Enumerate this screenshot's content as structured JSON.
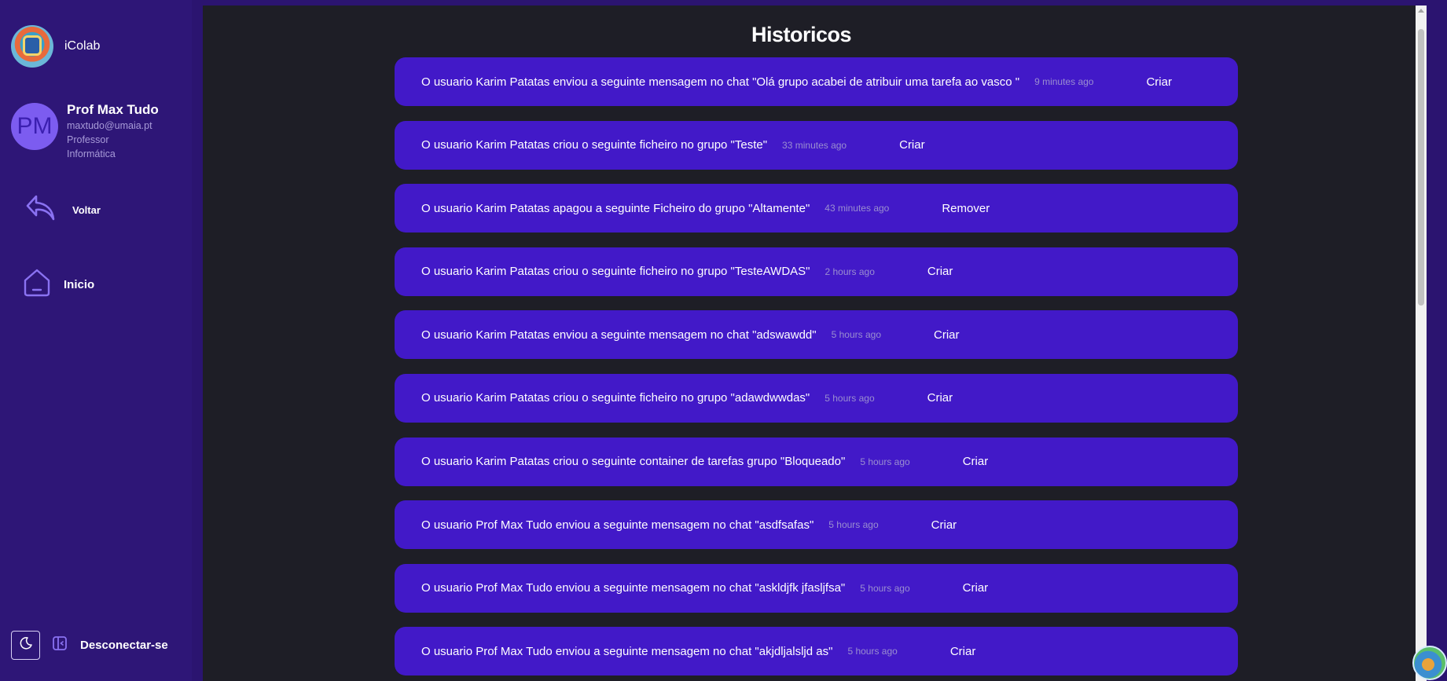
{
  "app": {
    "name": "iColab"
  },
  "profile": {
    "initials": "PM",
    "name": "Prof Max Tudo",
    "email": "maxtudo@umaia.pt",
    "role": "Professor",
    "department": "Informática"
  },
  "nav": {
    "back_label": "Voltar",
    "home_label": "Inicio",
    "logout_label": "Desconectar-se"
  },
  "main": {
    "title": "Historicos"
  },
  "history": [
    {
      "message": "O usuario Karim Patatas enviou a seguinte mensagem no chat \"Olá grupo acabei de atribuir uma tarefa ao vasco \"",
      "time": "9 minutes ago",
      "action": "Criar"
    },
    {
      "message": "O usuario Karim Patatas criou o seguinte ficheiro no grupo \"Teste\"",
      "time": "33 minutes ago",
      "action": "Criar"
    },
    {
      "message": "O usuario Karim Patatas apagou a seguinte Ficheiro do grupo \"Altamente\"",
      "time": "43 minutes ago",
      "action": "Remover"
    },
    {
      "message": "O usuario Karim Patatas criou o seguinte ficheiro no grupo \"TesteAWDAS\"",
      "time": "2 hours ago",
      "action": "Criar"
    },
    {
      "message": "O usuario Karim Patatas enviou a seguinte mensagem no chat \"adswawdd\"",
      "time": "5 hours ago",
      "action": "Criar"
    },
    {
      "message": "O usuario Karim Patatas criou o seguinte ficheiro no grupo \"adawdwwdas\"",
      "time": "5 hours ago",
      "action": "Criar"
    },
    {
      "message": "O usuario Karim Patatas criou o seguinte container de tarefas grupo \"Bloqueado\"",
      "time": "5 hours ago",
      "action": "Criar"
    },
    {
      "message": "O usuario Prof Max Tudo enviou a seguinte mensagem no chat \"asdfsafas\"",
      "time": "5 hours ago",
      "action": "Criar"
    },
    {
      "message": "O usuario Prof Max Tudo enviou a seguinte mensagem no chat \"askldjfk jfasljfsa\"",
      "time": "5 hours ago",
      "action": "Criar"
    },
    {
      "message": "O usuario Prof Max Tudo enviou a seguinte mensagem no chat \"akjdljalsljd as\"",
      "time": "5 hours ago",
      "action": "Criar"
    }
  ],
  "colors": {
    "sidebar": "#2e1677",
    "main_bg": "#1e1e26",
    "row_bg": "#4219c8",
    "accent": "#7c5cf0"
  }
}
